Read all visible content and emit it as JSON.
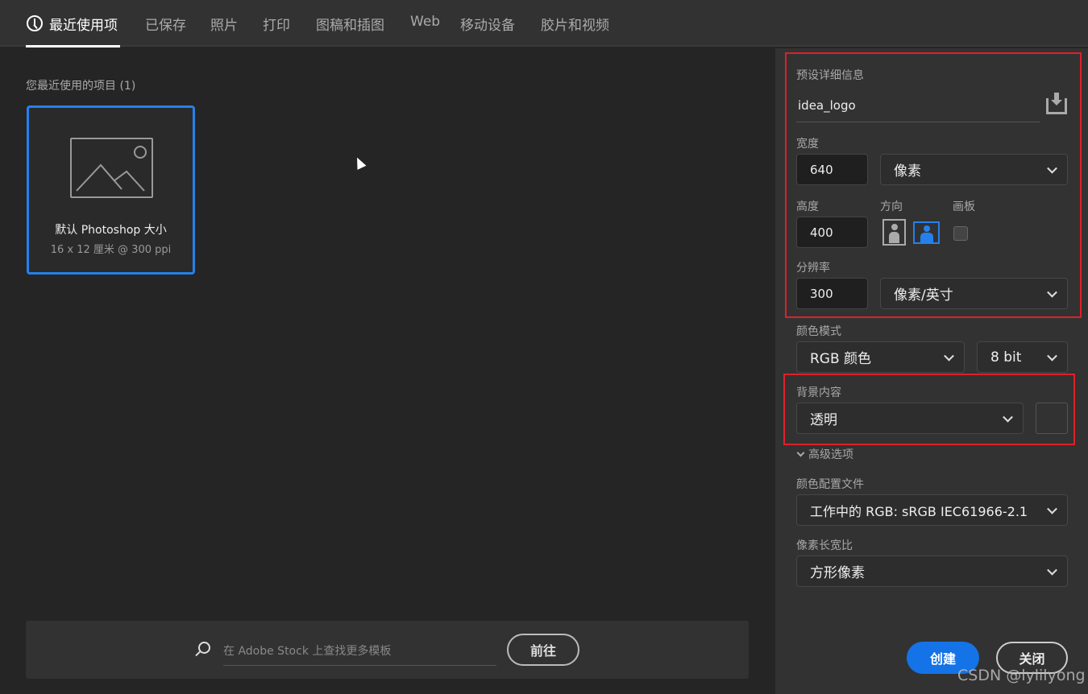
{
  "tabs": [
    {
      "label": "最近使用项",
      "icon": "clock-icon"
    },
    {
      "label": "已保存"
    },
    {
      "label": "照片"
    },
    {
      "label": "打印"
    },
    {
      "label": "图稿和插图"
    },
    {
      "label": "Web"
    },
    {
      "label": "移动设备"
    },
    {
      "label": "胶片和视频"
    }
  ],
  "recent": {
    "title": "您最近使用的项目",
    "count": "(1)",
    "items": [
      {
        "name": "默认 Photoshop 大小",
        "desc": "16 x 12 厘米 @ 300 ppi",
        "icon": "image-icon"
      }
    ]
  },
  "stock": {
    "placeholder": "在 Adobe Stock 上查找更多模板",
    "go_label": "前往"
  },
  "preset": {
    "title": "预设详细信息",
    "name": "idea_logo",
    "save_icon": "save-preset-icon",
    "width_label": "宽度",
    "width": "640",
    "width_unit": "像素",
    "height_label": "高度",
    "height": "400",
    "orientation_label": "方向",
    "orientation": "landscape",
    "artboard_label": "画板",
    "artboard": false,
    "resolution_label": "分辨率",
    "resolution": "300",
    "resolution_unit": "像素/英寸",
    "color_mode_label": "颜色模式",
    "color_mode": "RGB 颜色",
    "bit_depth": "8 bit",
    "bg_label": "背景内容",
    "bg": "透明",
    "advanced_label": "高级选项",
    "profile_label": "颜色配置文件",
    "profile": "工作中的 RGB: sRGB IEC61966-2.1",
    "aspect_label": "像素长宽比",
    "aspect": "方形像素"
  },
  "buttons": {
    "create": "创建",
    "close": "关闭"
  },
  "watermark": "CSDN @lylilyong",
  "colors": {
    "accent": "#1473e6",
    "highlight": "#e0202a"
  }
}
